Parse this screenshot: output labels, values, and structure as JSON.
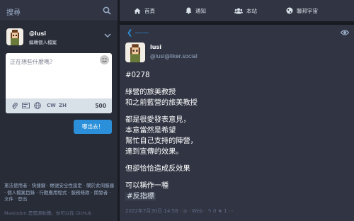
{
  "search": {
    "placeholder": "搜尋"
  },
  "account": {
    "handle": "@lusi",
    "edit_profile": "編輯個人檔案"
  },
  "compose": {
    "placeholder": "正在想些什麼嗎？",
    "cw_label": "CW",
    "lang_label": "ZH",
    "char_count": "500",
    "toot_button": "嘟出去！"
  },
  "footer": {
    "links": "憲法使用者 · 快捷鍵 · 帳號安全性設定 · 關於此伺服器 · 個人檔案目錄 · 行動應用程式 · 服務條款 · 開發者 · 文件 · 登出",
    "source": "Mastodon 是開源軟體。你可以在 GitHub"
  },
  "nav": {
    "home": "首頁",
    "notifications": "通知",
    "local": "本站",
    "federated": "聯邦宇宙"
  },
  "status": {
    "display_name": "lusi",
    "acct": "@lusi@liker.social",
    "paragraphs": [
      "#0278",
      "綠營的旅美教授\n和之前藍營的旅美教授",
      "都是很愛發表意見，\n本意當然是希望\n幫忙自己支持的陣營，\n達到宣傳的效果。",
      "但卻恰恰造成反效果",
      "可以稱作一種"
    ],
    "hashtag": "#反指標",
    "meta": "2022年7月30日 14:58 · ◎ · Web · ↰ 0 ★ 1 ⋯"
  },
  "colors": {
    "background": "#191b22",
    "panel": "#282c37",
    "bar": "#313543",
    "accent": "#2b90d9"
  }
}
